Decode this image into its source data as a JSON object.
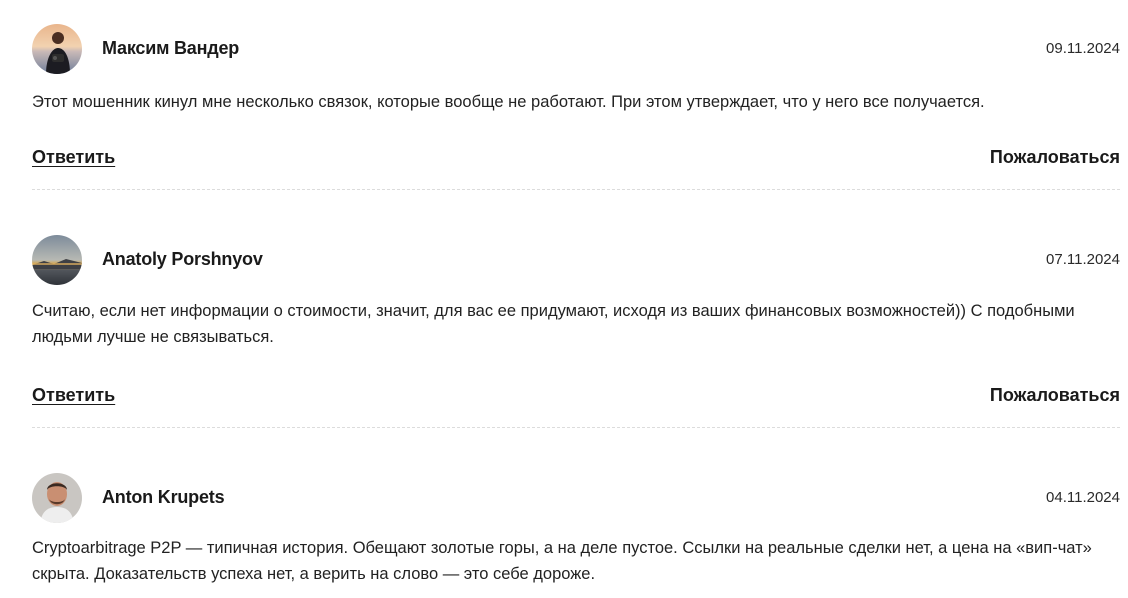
{
  "comments": [
    {
      "author": "Максим Вандер",
      "date": "09.11.2024",
      "text": "Этот мошенник кинул мне несколько связок, которые вообще не работают. При этом утверждает, что у него все получается.",
      "reply_label": "Ответить",
      "report_label": "Пожаловаться",
      "avatar_icon": "user-avatar-sunset-photo"
    },
    {
      "author": "Anatoly Porshnyov",
      "date": "07.11.2024",
      "text": "Считаю, если нет информации о стоимости, значит, для вас ее придумают, исходя из ваших финансовых возможностей)) С подобными людьми лучше не связываться.",
      "reply_label": "Ответить",
      "report_label": "Пожаловаться",
      "avatar_icon": "user-avatar-sea-landscape"
    },
    {
      "author": "Anton Krupets",
      "date": "04.11.2024",
      "text": "Cryptoarbitrage P2P — типичная история. Обещают золотые горы, а на деле пустое. Ссылки на реальные сделки нет, а цена на «вип-чат» скрыта. Доказательств успеха нет, а верить на слово — это себе дороже.",
      "avatar_icon": "user-avatar-portrait"
    }
  ]
}
